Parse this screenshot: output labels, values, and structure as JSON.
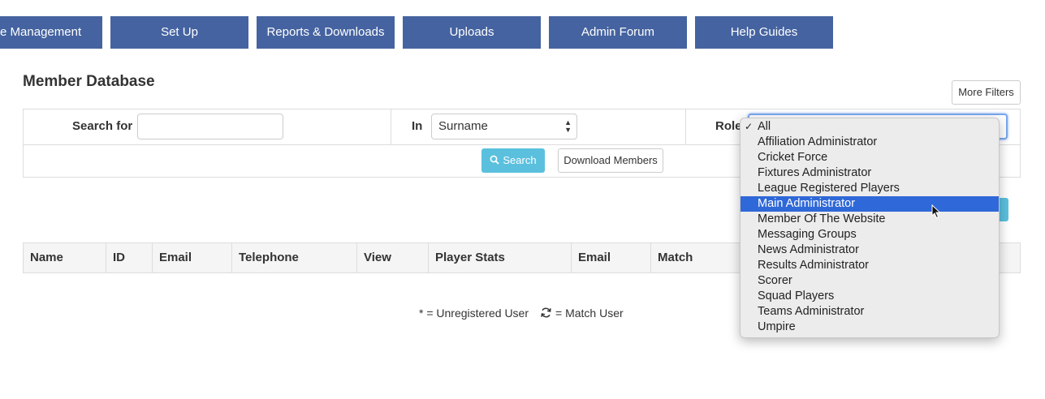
{
  "nav": [
    {
      "label": "te Management"
    },
    {
      "label": "Set Up"
    },
    {
      "label": "Reports & Downloads"
    },
    {
      "label": "Uploads"
    },
    {
      "label": "Admin Forum"
    },
    {
      "label": "Help Guides"
    }
  ],
  "page_title": "Member Database",
  "more_filters_label": "More Filters",
  "filters": {
    "search_for_label": "Search for",
    "search_value": "",
    "in_label": "In",
    "in_value": "Surname",
    "role_label": "Role",
    "search_button": "Search",
    "download_button": "Download Members"
  },
  "table": {
    "columns": [
      "Name",
      "ID",
      "Email",
      "Telephone",
      "View",
      "Player Stats",
      "Email",
      "Match"
    ]
  },
  "legend": {
    "unregistered": "* = Unregistered User",
    "match_user": "= Match User"
  },
  "role_dropdown": {
    "selected": "All",
    "highlighted": "Main Administrator",
    "options": [
      "All",
      "Affiliation Administrator",
      "Cricket Force",
      "Fixtures Administrator",
      "League Registered Players",
      "Main Administrator",
      "Member Of The Website",
      "Messaging Groups",
      "News Administrator",
      "Results Administrator",
      "Scorer",
      "Squad Players",
      "Teams Administrator",
      "Umpire"
    ]
  },
  "colors": {
    "nav_bg": "#4563a0",
    "search_button_bg": "#5bc0de",
    "highlight": "#2f68d8"
  }
}
